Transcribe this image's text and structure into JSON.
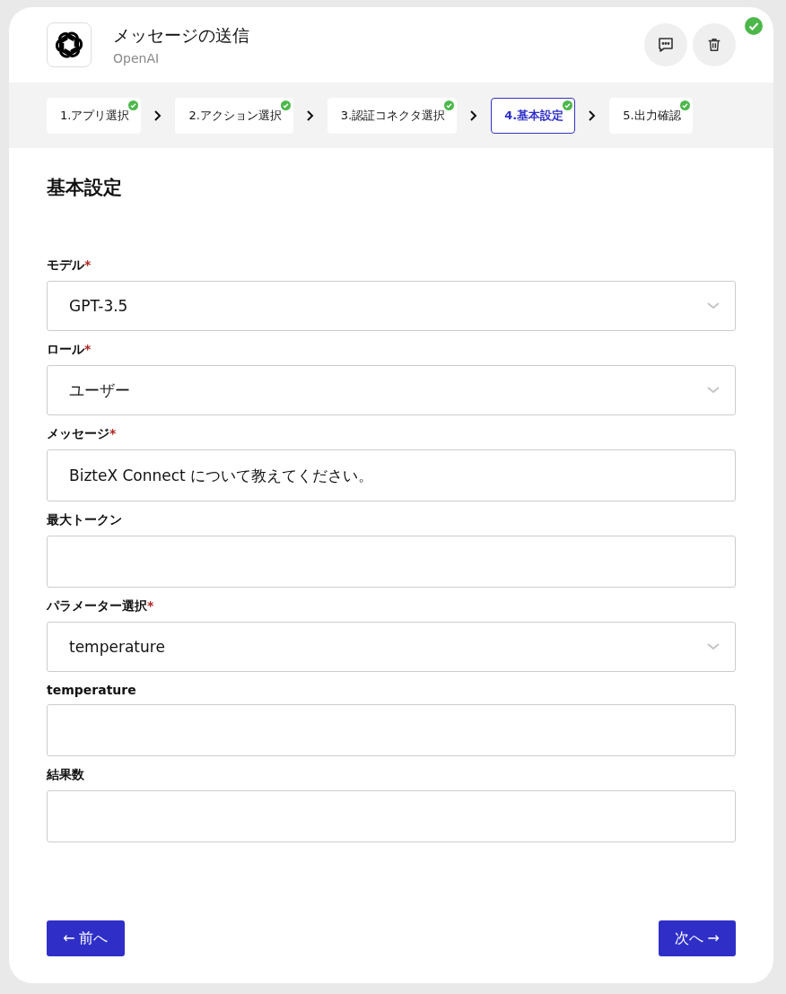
{
  "header": {
    "title": "メッセージの送信",
    "subtitle": "OpenAI",
    "completed": true
  },
  "steps": [
    {
      "label": "1.アプリ選択",
      "done": true,
      "selected": false
    },
    {
      "label": "2.アクション選択",
      "done": true,
      "selected": false
    },
    {
      "label": "3.認証コネクタ選択",
      "done": true,
      "selected": false
    },
    {
      "label": "4.基本設定",
      "done": true,
      "selected": true
    },
    {
      "label": "5.出力確認",
      "done": true,
      "selected": false
    }
  ],
  "section_title": "基本設定",
  "required_mark": "*",
  "fields": [
    {
      "label": "モデル",
      "required": true,
      "kind": "select",
      "value": "GPT-3.5"
    },
    {
      "label": "ロール",
      "required": true,
      "kind": "select",
      "value": "ユーザー"
    },
    {
      "label": "メッセージ",
      "required": true,
      "kind": "text",
      "value": "BizteX Connect について教えてください。"
    },
    {
      "label": "最大トークン",
      "required": false,
      "kind": "text"
    },
    {
      "label": "パラメーター選択",
      "required": true,
      "kind": "select",
      "value": "temperature"
    },
    {
      "label": "temperature",
      "required": false,
      "kind": "text"
    },
    {
      "label": "結果数",
      "required": false,
      "kind": "text"
    }
  ],
  "buttons": {
    "back": "← 前へ",
    "next": "次へ →"
  }
}
